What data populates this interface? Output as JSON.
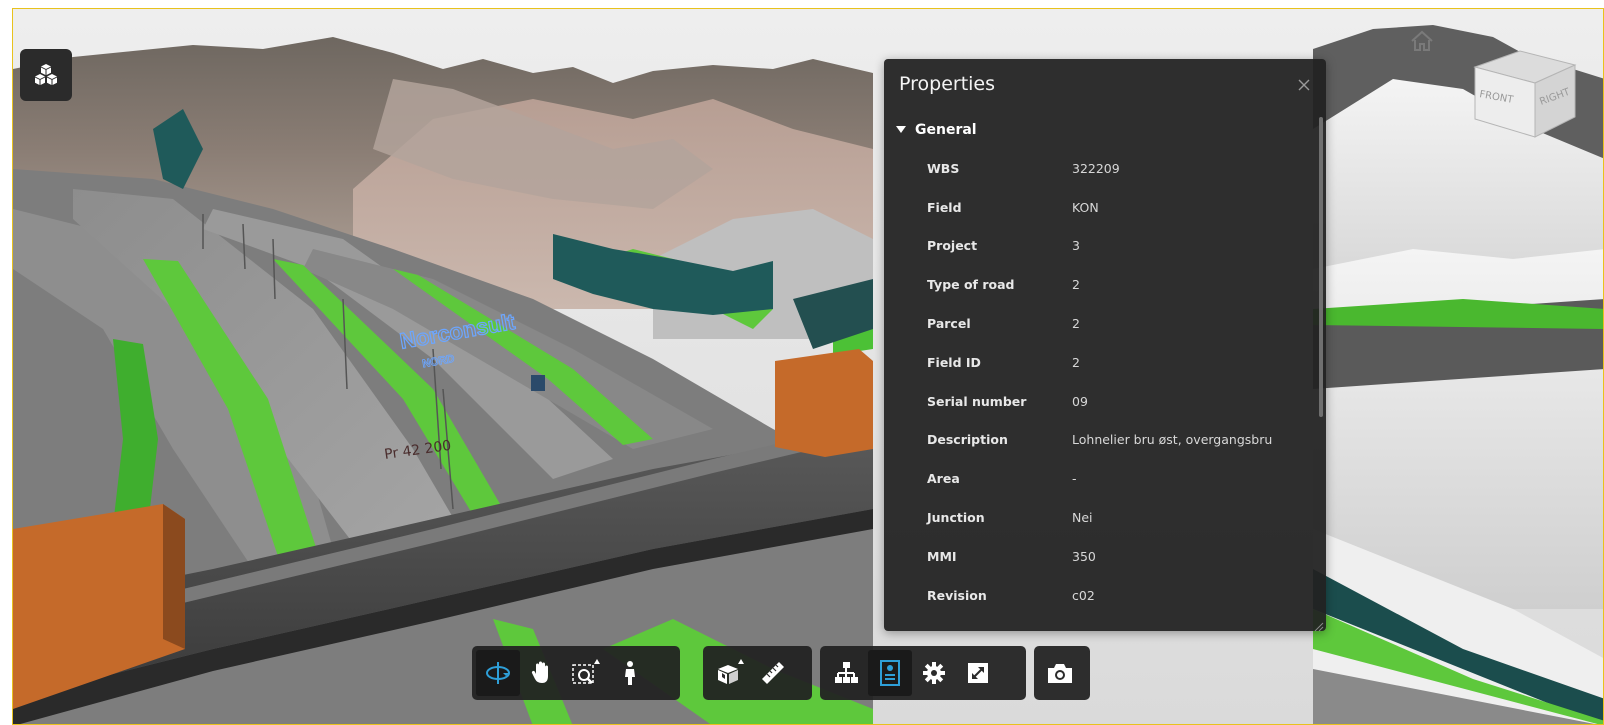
{
  "viewer": {
    "accent": "#2e9fd8",
    "frame_color": "#e8c21d",
    "sign": {
      "brand": "Norconsult",
      "sub": "NORD"
    }
  },
  "viewcube": {
    "front": "FRONT",
    "right": "RIGHT"
  },
  "properties": {
    "title": "Properties",
    "section": "General",
    "rows": [
      {
        "key": "WBS",
        "value": "322209"
      },
      {
        "key": "Field",
        "value": "KON"
      },
      {
        "key": "Project",
        "value": "3"
      },
      {
        "key": "Type of road",
        "value": "2"
      },
      {
        "key": "Parcel",
        "value": "2"
      },
      {
        "key": "Field ID",
        "value": "2"
      },
      {
        "key": "Serial number",
        "value": "09"
      },
      {
        "key": "Description",
        "value": "Lohnelier bru øst, overgangsbru"
      },
      {
        "key": "Area",
        "value": "-"
      },
      {
        "key": "Junction",
        "value": "Nei"
      },
      {
        "key": "MMI",
        "value": "350"
      },
      {
        "key": "Revision",
        "value": "c02"
      }
    ]
  },
  "toolbar": {
    "groups": [
      [
        "orbit-icon",
        "pan-icon",
        "zoom-window-icon",
        "first-person-icon"
      ],
      [
        "section-box-icon",
        "measure-icon"
      ],
      [
        "model-browser-icon",
        "properties-icon",
        "settings-icon",
        "fullscreen-icon"
      ],
      [
        "camera-icon"
      ]
    ],
    "active": [
      "orbit-icon",
      "properties-icon"
    ]
  }
}
